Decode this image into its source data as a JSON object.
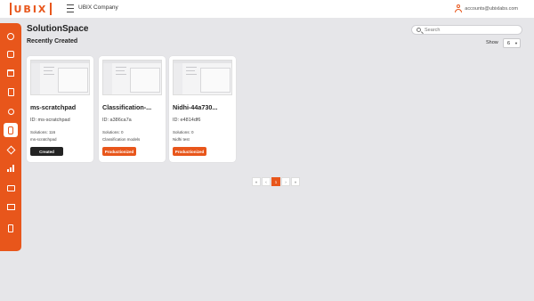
{
  "app": {
    "logo_text": "UBIX",
    "company": "UBIX Company",
    "account_email": "accounts@ubixlabs.com"
  },
  "colors": {
    "accent": "#e8561b",
    "background": "#e6e6e9",
    "created_button": "#232323"
  },
  "sidebar": {
    "items": [
      {
        "icon": "circle-icon"
      },
      {
        "icon": "nodes-icon"
      },
      {
        "icon": "home-icon"
      },
      {
        "icon": "document-icon"
      },
      {
        "icon": "network-icon"
      },
      {
        "icon": "solution-space-icon",
        "active": true
      },
      {
        "icon": "cube-icon"
      },
      {
        "icon": "bar-chart-icon"
      },
      {
        "icon": "data-icon"
      },
      {
        "icon": "monitor-icon"
      },
      {
        "icon": "logout-icon"
      }
    ]
  },
  "page": {
    "title": "SolutionSpace",
    "section_title": "Recently Created"
  },
  "search": {
    "placeholder": "Search"
  },
  "show": {
    "label": "Show",
    "value": "6"
  },
  "cards": [
    {
      "title": "ms-scratchpad",
      "id": "ID: ms-scratchpad",
      "solutions": "Solutions: 116",
      "description": "ms-scratchpad",
      "status": "Created"
    },
    {
      "title": "Classification-...",
      "id": "ID: a386ca7a",
      "solutions": "Solutions: 0",
      "description": "Classification models",
      "status": "Productionized"
    },
    {
      "title": "Nidhi-44a730...",
      "id": "ID: e4814df6",
      "solutions": "Solutions: 0",
      "description": "Nidhi test",
      "status": "Productionized"
    }
  ],
  "pagination": {
    "first": "«",
    "prev": "‹",
    "current": "1",
    "next": "›",
    "last": "»"
  }
}
